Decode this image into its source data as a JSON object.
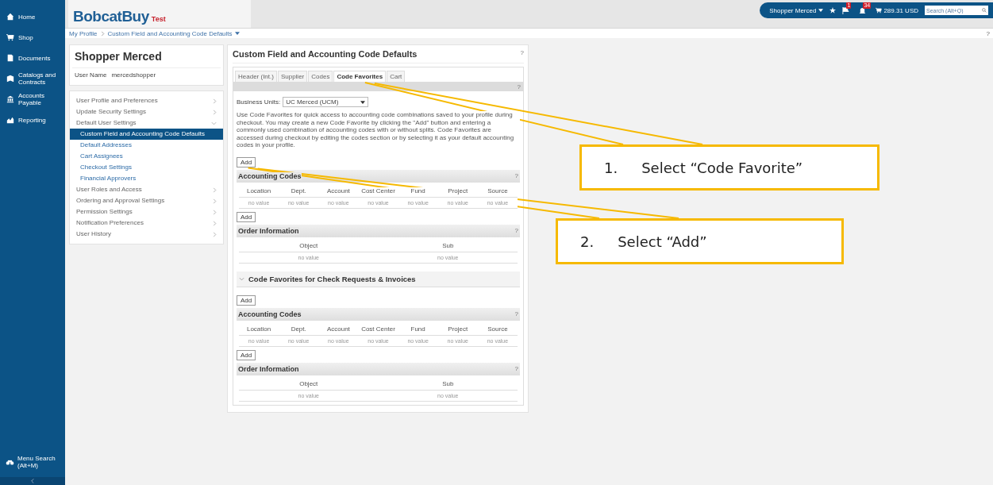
{
  "nav": {
    "items": [
      {
        "label": "Home"
      },
      {
        "label": "Shop"
      },
      {
        "label": "Documents"
      },
      {
        "label": "Catalogs and Contracts"
      },
      {
        "label": "Accounts Payable"
      },
      {
        "label": "Reporting"
      }
    ],
    "search": {
      "label": "Menu Search",
      "shortcut": "(Alt+M)"
    }
  },
  "header": {
    "logo": "BobcatBuy",
    "environment": "Test",
    "user": "Shopper Merced",
    "flag_count": "1",
    "alert_count": "34",
    "cart_total": "289.31 USD",
    "search_placeholder": "Search (Alt+Q)",
    "help": "?"
  },
  "breadcrumb": [
    "My Profile",
    "Custom Field and Accounting Code Defaults"
  ],
  "profile": {
    "name": "Shopper Merced",
    "username_label": "User Name",
    "username": "mercedshopper"
  },
  "menu": [
    {
      "label": "User Profile and Preferences",
      "expanded": false,
      "selected": false
    },
    {
      "label": "Update Security Settings",
      "expanded": false,
      "selected": false
    },
    {
      "label": "Default User Settings",
      "expanded": true,
      "selected": false,
      "children": [
        {
          "label": "Custom Field and Accounting Code Defaults",
          "selected": true
        },
        {
          "label": "Default Addresses",
          "selected": false
        },
        {
          "label": "Cart Assignees",
          "selected": false
        },
        {
          "label": "Checkout Settings",
          "selected": false
        },
        {
          "label": "Financial Approvers",
          "selected": false
        }
      ]
    },
    {
      "label": "User Roles and Access",
      "expanded": false,
      "selected": false
    },
    {
      "label": "Ordering and Approval Settings",
      "expanded": false,
      "selected": false
    },
    {
      "label": "Permission Settings",
      "expanded": false,
      "selected": false
    },
    {
      "label": "Notification Preferences",
      "expanded": false,
      "selected": false
    },
    {
      "label": "User History",
      "expanded": false,
      "selected": false
    }
  ],
  "main": {
    "title": "Custom Field and Accounting Code Defaults",
    "help": "?",
    "tabs": [
      {
        "label": "Header (Int.)",
        "selected": false
      },
      {
        "label": "Supplier",
        "selected": false
      },
      {
        "label": "Codes",
        "selected": false
      },
      {
        "label": "Code Favorites",
        "selected": true
      },
      {
        "label": "Cart",
        "selected": false
      }
    ],
    "bar_help": "?",
    "business_units": {
      "label": "Business Units:",
      "value": "UC Merced (UCM)"
    },
    "description": "Use Code Favorites for quick access to accounting code combinations saved to your profile during checkout. You may create a new Code Favorite by clicking the \"Add\" button and entering a commonly used combination of accounting codes with or without splits. Code Favorites are accessed during checkout by editing the codes section or by selecting it as your default accounting codes in your profile.",
    "sections": [
      {
        "add": "Add",
        "title": "Accounting Codes",
        "help": "?",
        "columns": [
          "Location",
          "Dept.",
          "Account",
          "Cost Center",
          "Fund",
          "Project",
          "Source"
        ],
        "values": [
          "no value",
          "no value",
          "no value",
          "no value",
          "no value",
          "no value",
          "no value"
        ]
      },
      {
        "add": "Add",
        "title": "Order Information",
        "help": "?",
        "columns": [
          "Object",
          "Sub"
        ],
        "values": [
          "no value",
          "no value"
        ]
      }
    ],
    "group": {
      "title": "Code Favorites for Check Requests & Invoices",
      "expanded": true,
      "sections": [
        {
          "add": "Add",
          "title": "Accounting Codes",
          "help": "?",
          "columns": [
            "Location",
            "Dept.",
            "Account",
            "Cost Center",
            "Fund",
            "Project",
            "Source"
          ],
          "values": [
            "no value",
            "no value",
            "no value",
            "no value",
            "no value",
            "no value",
            "no value"
          ]
        },
        {
          "add": "Add",
          "title": "Order Information",
          "help": "?",
          "columns": [
            "Object",
            "Sub"
          ],
          "values": [
            "no value",
            "no value"
          ]
        }
      ]
    }
  },
  "annotations": [
    {
      "number": "1.",
      "text": "Select “Code Favorite”"
    },
    {
      "number": "2.",
      "text": "Select “Add”"
    }
  ]
}
